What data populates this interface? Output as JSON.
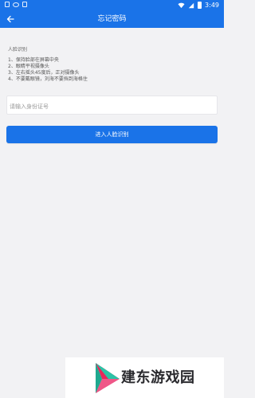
{
  "status_bar": {
    "time": "3:49",
    "icons": [
      "notification-icon",
      "voicemail-icon",
      "app-badge-icon",
      "wifi-icon",
      "signal-icon",
      "battery-icon"
    ]
  },
  "header": {
    "title": "忘记密码",
    "back_icon": "back-arrow-icon"
  },
  "instructions": {
    "title": "人脸识别",
    "items": [
      "1、保持脸部在屏幕中央",
      "2、眼睛平视摄像头",
      "3、左右摇头45度后，正对摄像头",
      "4、不要戴眼镜，刘海不要挡到海格住"
    ]
  },
  "id_input": {
    "value": "",
    "placeholder": "请输入身份证号"
  },
  "submit_button": {
    "label": "进入人脸识别"
  },
  "watermark": {
    "text": "建东游戏园"
  },
  "colors": {
    "primary": "#1a73e8",
    "background": "#f2f2f4",
    "text_muted": "#666666"
  }
}
